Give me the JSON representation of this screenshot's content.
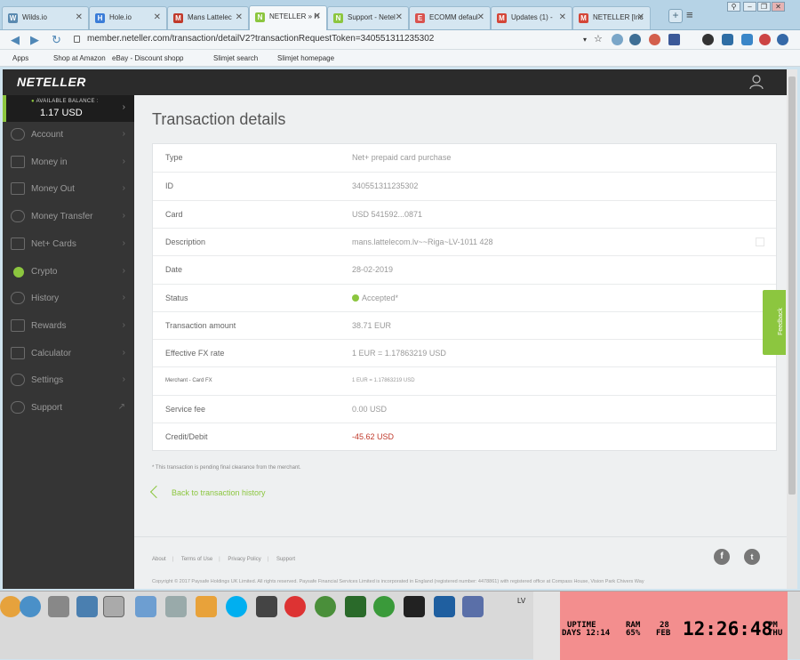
{
  "browser": {
    "tabs": [
      {
        "label": "Wilds.io",
        "fav_color": "#5a8ab0",
        "fav": "W"
      },
      {
        "label": "Hole.io",
        "fav_color": "#3b7dd8",
        "fav": "H"
      },
      {
        "label": "Mans Lattelec",
        "fav_color": "#c0392b",
        "fav": "M"
      },
      {
        "label": "NETELLER » H",
        "fav_color": "#8cc63f",
        "fav": "N",
        "active": true
      },
      {
        "label": "Support - Netel",
        "fav_color": "#8cc63f",
        "fav": "N"
      },
      {
        "label": "ECOMM defaul",
        "fav_color": "#d9534f",
        "fav": "E"
      },
      {
        "label": "Updates (1) -",
        "fav_color": "#d44638",
        "fav": "M"
      },
      {
        "label": "NETELLER [Inc",
        "fav_color": "#d44638",
        "fav": "M"
      }
    ],
    "url": "member.neteller.com/transaction/detailV2?transactionRequestToken=340551311235302",
    "bookmarks": [
      {
        "label": "Apps"
      },
      {
        "label": "Shop at Amazon"
      },
      {
        "label": "eBay - Discount shopp"
      },
      {
        "label": "Slimjet search"
      },
      {
        "label": "Slimjet homepage"
      }
    ]
  },
  "header": {
    "logo": "NETELLER"
  },
  "sidebar": {
    "balance_label": "AVAILABLE BALANCE :",
    "balance_value": "1.17 USD",
    "items": [
      {
        "label": "Account",
        "icon": "user-icon"
      },
      {
        "label": "Money in",
        "icon": "money-in-icon"
      },
      {
        "label": "Money Out",
        "icon": "money-out-icon"
      },
      {
        "label": "Money Transfer",
        "icon": "money-transfer-icon"
      },
      {
        "label": "Net+ Cards",
        "icon": "card-icon"
      },
      {
        "label": "Crypto",
        "icon": "crypto-icon"
      },
      {
        "label": "History",
        "icon": "history-icon"
      },
      {
        "label": "Rewards",
        "icon": "rewards-icon"
      },
      {
        "label": "Calculator",
        "icon": "calculator-icon"
      },
      {
        "label": "Settings",
        "icon": "gear-icon"
      },
      {
        "label": "Support",
        "icon": "help-icon"
      }
    ]
  },
  "main": {
    "title": "Transaction details",
    "rows": [
      {
        "key": "Type",
        "value": "Net+ prepaid card purchase"
      },
      {
        "key": "ID",
        "value": "340551311235302"
      },
      {
        "key": "Card",
        "value": "USD 541592...0871"
      },
      {
        "key": "Description",
        "value": "mans.lattelecom.lv~~Riga~LV-1011 428"
      },
      {
        "key": "Date",
        "value": "28-02-2019"
      },
      {
        "key": "Status",
        "value": "Accepted*"
      },
      {
        "key": "Transaction amount",
        "value": "38.71 EUR"
      },
      {
        "key": "Effective FX rate",
        "value": "1 EUR = 1.17863219 USD"
      },
      {
        "key": "Merchant - Card FX",
        "value": "1 EUR = 1.17863219 USD"
      },
      {
        "key": "Service fee",
        "value": "0.00 USD"
      },
      {
        "key": "Credit/Debit",
        "value": "-45.62 USD"
      }
    ],
    "note": "* This transaction is pending final clearance from the merchant.",
    "back_link": "Back to transaction history",
    "status_color": "#8cc63f"
  },
  "footer": {
    "links": [
      "About",
      "Terms of Use",
      "Privacy Policy",
      "Support"
    ],
    "copyright": "Copyright © 2017 Paysafe Holdings UK Limited. All rights reserved. Paysafe Financial Services Limited is incorporated in England (registered number: 4478861) with registered office at Compass House, Vision Park Chivers Way"
  },
  "feedback": {
    "label": "Feedback"
  },
  "taskbar": {
    "lang": "LV",
    "clock": {
      "uptime_label": "UPTIME",
      "uptime_value": "DAYS 12:14",
      "ram_label": "RAM",
      "ram_value": "65%",
      "day": "28",
      "month": "FEB",
      "time": "12:26:48",
      "ampm": "PM",
      "weekday": "THU"
    }
  },
  "colors": {
    "brand_green": "#8cc63f",
    "sidebar_bg": "#353535",
    "topbar_bg": "#2b2b2b",
    "debit_red": "#c0392b"
  }
}
